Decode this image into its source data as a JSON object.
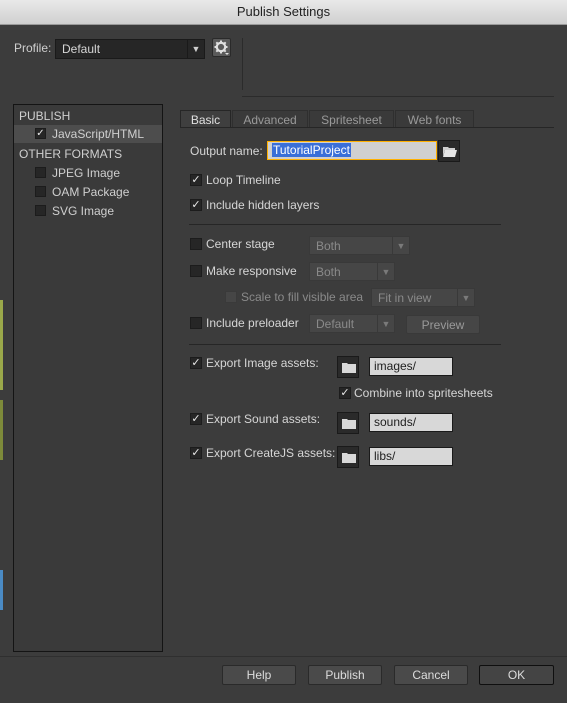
{
  "window": {
    "title": "Publish Settings"
  },
  "profile": {
    "label": "Profile:",
    "value": "Default",
    "gear_icon": "gear-icon"
  },
  "left_panel": {
    "publish_section": "PUBLISH",
    "publish_items": [
      {
        "label": "JavaScript/HTML",
        "checked": true
      }
    ],
    "other_section": "OTHER FORMATS",
    "other_items": [
      {
        "label": "JPEG Image",
        "checked": false
      },
      {
        "label": "OAM Package",
        "checked": false
      },
      {
        "label": "SVG Image",
        "checked": false
      }
    ]
  },
  "tabs": [
    {
      "label": "Basic",
      "active": true
    },
    {
      "label": "Advanced",
      "active": false
    },
    {
      "label": "Spritesheet",
      "active": false
    },
    {
      "label": "Web fonts",
      "active": false
    }
  ],
  "basic": {
    "output_name_label": "Output name:",
    "output_name_value": "TutorialProject",
    "loop_timeline": {
      "label": "Loop Timeline",
      "checked": true
    },
    "include_hidden_layers": {
      "label": "Include hidden layers",
      "checked": true
    },
    "center_stage": {
      "label": "Center stage",
      "checked": false,
      "value": "Both"
    },
    "make_responsive": {
      "label": "Make responsive",
      "checked": false,
      "value": "Both"
    },
    "scale_to_fill": {
      "label": "Scale to fill visible area",
      "checked": false,
      "value": "Fit in view"
    },
    "include_preloader": {
      "label": "Include preloader",
      "checked": false,
      "value": "Default",
      "preview_label": "Preview"
    },
    "export_image": {
      "label": "Export Image assets:",
      "checked": true,
      "path": "images/"
    },
    "combine_spritesheets": {
      "label": "Combine into spritesheets",
      "checked": true
    },
    "export_sound": {
      "label": "Export Sound assets:",
      "checked": true,
      "path": "sounds/"
    },
    "export_createjs": {
      "label": "Export CreateJS assets:",
      "checked": true,
      "path": "libs/"
    }
  },
  "footer": {
    "help": "Help",
    "publish": "Publish",
    "cancel": "Cancel",
    "ok": "OK"
  }
}
